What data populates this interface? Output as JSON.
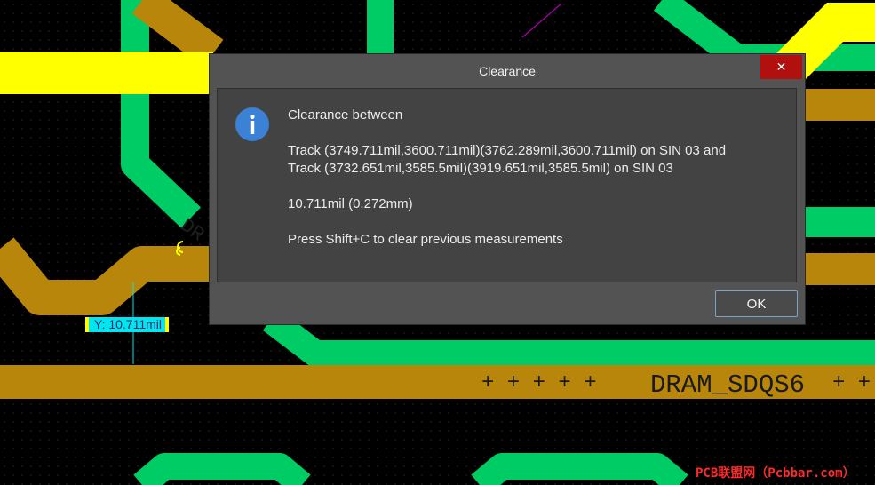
{
  "dialog": {
    "title": "Clearance",
    "close_label": "✕",
    "icon": "info-icon",
    "heading": "Clearance between",
    "track_line_1": "Track (3749.711mil,3600.711mil)(3762.289mil,3600.711mil) on SIN 03 and",
    "track_line_2": "Track (3732.651mil,3585.5mil)(3919.651mil,3585.5mil) on SIN 03",
    "distance": "10.711mil (0.272mm)",
    "hint": "Press Shift+C to clear previous measurements",
    "ok_label": "OK"
  },
  "board": {
    "net_label": "DRAM_SDQS6",
    "plus_left": "+ + + + +",
    "plus_right": "+ +",
    "measure_label": "Y: 10.711mil",
    "pad_text": "DR",
    "colors": {
      "track_green": "#00cc66",
      "track_gold": "#b8860b",
      "track_yellow": "#ffff00",
      "measure_cyan": "#00e5ee"
    }
  },
  "watermark": "PCB联盟网（Pcbbar.com）"
}
